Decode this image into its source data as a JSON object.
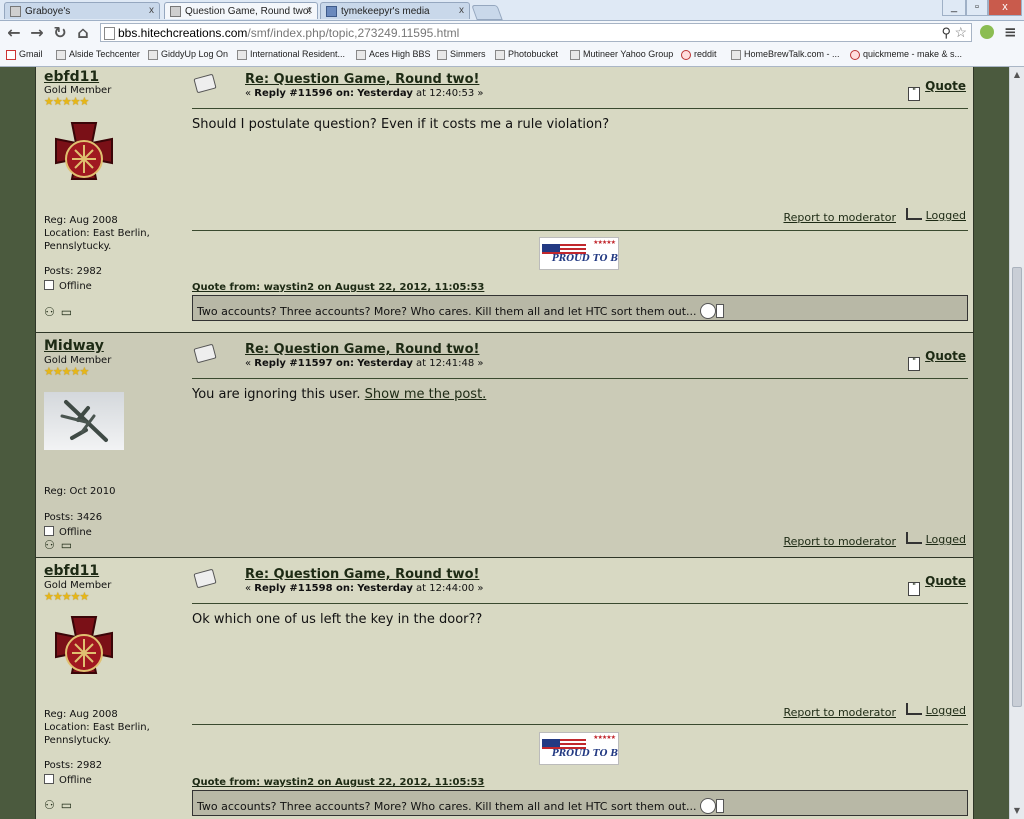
{
  "browser": {
    "tabs": [
      {
        "label": "Graboye's",
        "active": false
      },
      {
        "label": "Question Game, Round two!",
        "active": true
      },
      {
        "label": "tymekeepyr's media",
        "active": false
      }
    ],
    "window_controls": {
      "minimize": "_",
      "maximize": "▫",
      "close": "x"
    },
    "url": {
      "host": "bbs.hitechcreations.com",
      "path": "/smf/index.php/topic,273249.11595.html"
    },
    "bookmarks": [
      "Gmail",
      "Alside Techcenter",
      "GiddyUp Log On",
      "International Resident...",
      "Aces High BBS",
      "Simmers",
      "Photobucket",
      "Mutineer Yahoo Group",
      "reddit",
      "HomeBrewTalk.com - ...",
      "quickmeme - make & s..."
    ]
  },
  "colors": {
    "page_bg": "#4b5a3e",
    "post_bg_a": "#d8d9c3",
    "post_bg_b": "#cbcbb7",
    "link": "#1d2a14",
    "stars": "#e7b716"
  },
  "posts": [
    {
      "poster": {
        "name": "ebfd11",
        "rank": "Gold Member",
        "stars": "★★★★★",
        "avatar": "firefighter-maltese-cross",
        "info": "Reg: Aug 2008\nLocation: East Berlin,\nPennslytucky.",
        "posts": "Posts: 2982",
        "status": "Offline"
      },
      "subject": "Re: Question Game, Round two!",
      "meta_prefix": "« ",
      "meta_reply": "Reply #11596 on:",
      "meta_day": "Yesterday",
      "meta_time": " at 12:40:53 »",
      "quote_label": "Quote",
      "body": "Should I postulate question? Even if it costs me a rule violation?",
      "report_label": "Report to moderator",
      "logged_label": "Logged",
      "signature": {
        "image_text": "PROUD TO BE AN AMERICAN",
        "quote_header": "Quote from: waystin2 on August 22, 2012, 11:05:53",
        "quote_text": "Two accounts?  Three accounts?  More?  Who cares.  Kill them all and let HTC sort them out..."
      }
    },
    {
      "poster": {
        "name": "Midway",
        "rank": "Gold Member",
        "stars": "★★★★★",
        "avatar": "spitfire-airplane",
        "info": "Reg: Oct 2010",
        "posts": "Posts: 3426",
        "status": "Offline"
      },
      "subject": "Re: Question Game, Round two!",
      "meta_prefix": "« ",
      "meta_reply": "Reply #11597 on:",
      "meta_day": "Yesterday",
      "meta_time": " at 12:41:48 »",
      "quote_label": "Quote",
      "body": "You are ignoring this user. ",
      "body_link": "Show me the post.",
      "report_label": "Report to moderator",
      "logged_label": "Logged"
    },
    {
      "poster": {
        "name": "ebfd11",
        "rank": "Gold Member",
        "stars": "★★★★★",
        "avatar": "firefighter-maltese-cross",
        "info": "Reg: Aug 2008\nLocation: East Berlin,\nPennslytucky.",
        "posts": "Posts: 2982",
        "status": "Offline"
      },
      "subject": "Re: Question Game, Round two!",
      "meta_prefix": "« ",
      "meta_reply": "Reply #11598 on:",
      "meta_day": "Yesterday",
      "meta_time": " at 12:44:00 »",
      "quote_label": "Quote",
      "body": "Ok which one of us left the key in the door??",
      "report_label": "Report to moderator",
      "logged_label": "Logged",
      "signature": {
        "image_text": "PROUD TO BE AN AMERICAN",
        "quote_header": "Quote from: waystin2 on August 22, 2012, 11:05:53",
        "quote_text": "Two accounts?  Three accounts?  More?  Who cares.  Kill them all and let HTC sort them out..."
      }
    }
  ]
}
